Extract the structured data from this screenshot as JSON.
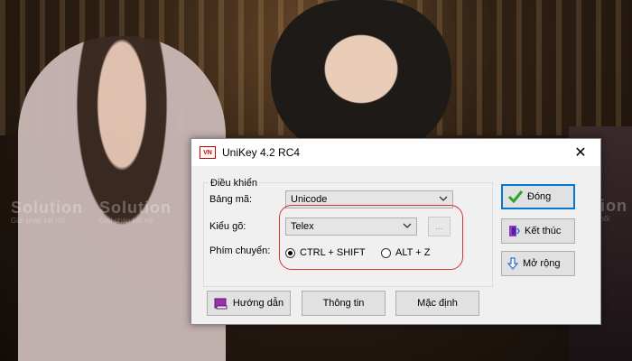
{
  "watermarks": {
    "brand": "Solution",
    "tagline": "Giải pháp kết nối"
  },
  "window": {
    "app_icon_text": "VN",
    "title": "UniKey 4.2 RC4",
    "close_glyph": "✕"
  },
  "controls": {
    "group_title": "Điều khiển",
    "charset_label": "Bảng mã:",
    "charset_value": "Unicode",
    "input_method_label": "Kiểu gõ:",
    "input_method_value": "Telex",
    "more_button": "...",
    "switch_label": "Phím chuyển:",
    "switch_options": [
      "CTRL + SHIFT",
      "ALT + Z"
    ],
    "switch_selected": "CTRL + SHIFT"
  },
  "side_buttons": {
    "close": "Đóng",
    "exit": "Kết thúc",
    "expand": "Mở rộng"
  },
  "bottom_buttons": {
    "guide": "Hướng dẫn",
    "info": "Thông tin",
    "default": "Mặc định"
  },
  "colors": {
    "highlight_box": "#d93030",
    "default_button_border": "#0078d7",
    "check_icon": "#2aa62a"
  }
}
